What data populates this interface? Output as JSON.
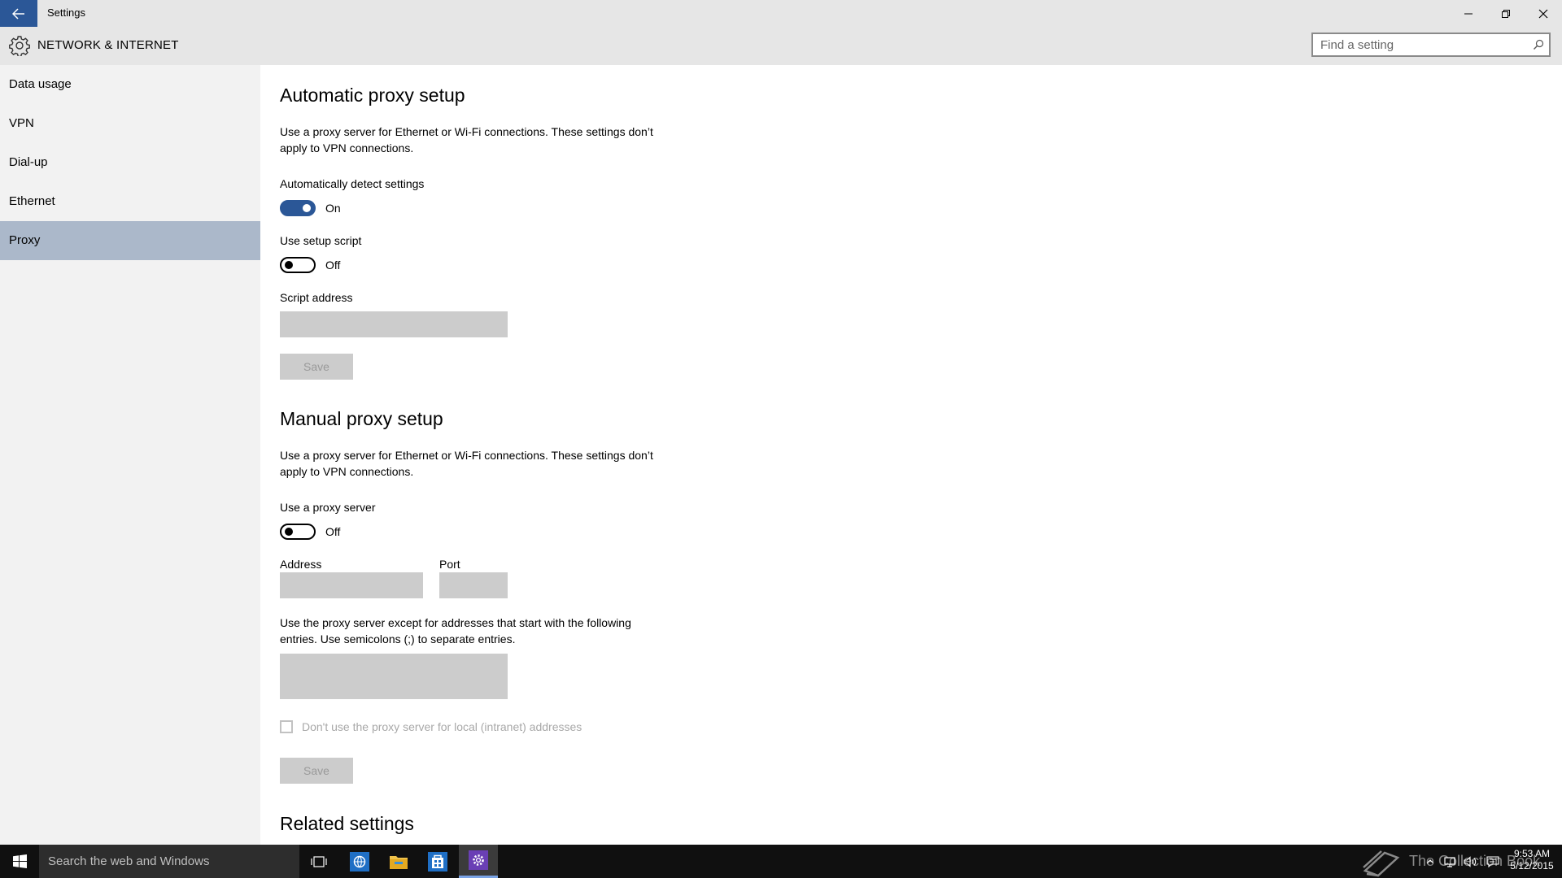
{
  "window": {
    "title": "Settings"
  },
  "header": {
    "section_title": "NETWORK & INTERNET",
    "search_placeholder": "Find a setting"
  },
  "sidebar": {
    "items": [
      {
        "label": "Data usage",
        "active": false
      },
      {
        "label": "VPN",
        "active": false
      },
      {
        "label": "Dial-up",
        "active": false
      },
      {
        "label": "Ethernet",
        "active": false
      },
      {
        "label": "Proxy",
        "active": true
      }
    ]
  },
  "auto_proxy": {
    "heading": "Automatic proxy setup",
    "description": "Use a proxy server for Ethernet or Wi-Fi connections. These settings don’t apply to VPN connections.",
    "detect_label": "Automatically detect settings",
    "detect_state": "On",
    "script_label": "Use setup script",
    "script_state": "Off",
    "script_address_label": "Script address",
    "script_address_value": "",
    "save_label": "Save"
  },
  "manual_proxy": {
    "heading": "Manual proxy setup",
    "description": "Use a proxy server for Ethernet or Wi-Fi connections. These settings don’t apply to VPN connections.",
    "use_proxy_label": "Use a proxy server",
    "use_proxy_state": "Off",
    "address_label": "Address",
    "address_value": "",
    "port_label": "Port",
    "port_value": "",
    "exceptions_description": "Use the proxy server except for addresses that start with the following entries. Use semicolons (;) to separate entries.",
    "exceptions_value": "",
    "local_checkbox_label": "Don't use the proxy server for local (intranet) addresses",
    "local_checkbox_checked": false,
    "save_label": "Save"
  },
  "related": {
    "heading": "Related settings"
  },
  "taskbar": {
    "search_placeholder": "Search the web and Windows",
    "watermark": "The Collection Book",
    "time": "9:53 AM",
    "date": "5/12/2015",
    "accent_color": "#7aa3e5"
  },
  "colors": {
    "accent": "#2b5797",
    "chrome": "#e6e6e6",
    "sidebar": "#f2f2f2",
    "selected_nav": "#abb8ca",
    "disabled_field": "#cccccc"
  }
}
